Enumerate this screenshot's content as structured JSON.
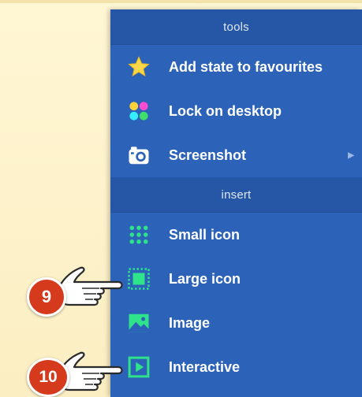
{
  "menu": {
    "sections": [
      {
        "header": "tools",
        "items": [
          {
            "label": "Add state to favourites",
            "icon": "star-icon"
          },
          {
            "label": "Lock on desktop",
            "icon": "colored-dots-icon"
          },
          {
            "label": "Screenshot",
            "icon": "camera-icon",
            "has_submenu": true
          }
        ]
      },
      {
        "header": "insert",
        "items": [
          {
            "label": "Small icon",
            "icon": "small-icon-grid-icon"
          },
          {
            "label": "Large icon",
            "icon": "large-icon-square-icon"
          },
          {
            "label": "Image",
            "icon": "image-icon"
          },
          {
            "label": "Interactive",
            "icon": "play-box-icon"
          }
        ]
      }
    ]
  },
  "callouts": [
    {
      "number": "9",
      "target": "Large icon"
    },
    {
      "number": "10",
      "target": "Interactive"
    }
  ],
  "colors": {
    "menu_bg": "#2c63b8",
    "header_bg": "#2656a6",
    "accent_green": "#2ee38a",
    "badge_red": "#d63a1c",
    "page_bg": "#fdf1c8"
  }
}
